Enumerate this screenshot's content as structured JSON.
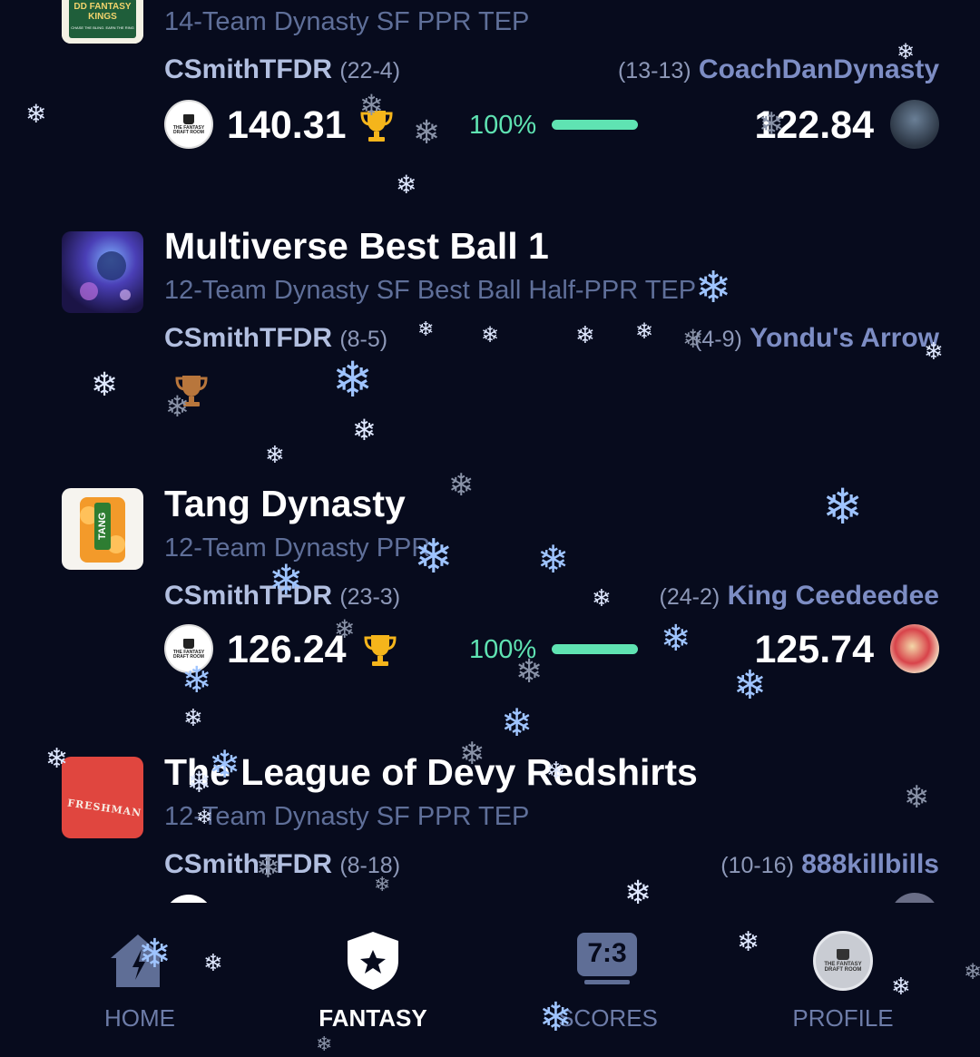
{
  "leagues": [
    {
      "name": "",
      "subtitle": "14-Team Dynasty SF PPR TEP",
      "thumb_text": "DD FANTASY KINGS",
      "thumb_tagline": "CHASE THE BLING. EARN THE RING",
      "my_team": "CSmithTFDR",
      "my_record": "(22-4)",
      "opponent": "CoachDanDynasty",
      "opponent_record": "(13-13)",
      "my_score": "140.31",
      "opponent_score": "122.84",
      "progress": "100%",
      "progress_value": 1.0
    },
    {
      "name": "Multiverse Best Ball 1",
      "subtitle": "12-Team Dynasty SF Best Ball Half-PPR TEP",
      "my_team": "CSmithTFDR",
      "my_record": "(8-5)",
      "opponent": "Yondu's Arrow",
      "opponent_record": "(4-9)"
    },
    {
      "name": "Tang Dynasty",
      "subtitle": "12-Team Dynasty PPR",
      "thumb_text": "TANG",
      "my_team": "CSmithTFDR",
      "my_record": "(23-3)",
      "opponent": "King Ceedeedee",
      "opponent_record": "(24-2)",
      "my_score": "126.24",
      "opponent_score": "125.74",
      "progress": "100%",
      "progress_value": 1.0
    },
    {
      "name": "The League of Devy Redshirts",
      "subtitle": "12-Team Dynasty SF PPR TEP",
      "thumb_text": "FRESHMAN",
      "my_team": "CSmithTFDR",
      "my_record": "(8-18)",
      "opponent": "888killbills",
      "opponent_record": "(10-16)"
    }
  ],
  "avatar_text": "THE FANTASY DRAFT ROOM",
  "nav": {
    "home": "HOME",
    "fantasy": "FANTASY",
    "scores": "SCORES",
    "scores_icon_text": "7:3",
    "profile": "PROFILE",
    "active": "fantasy"
  },
  "colors": {
    "background": "#070b1d",
    "accent_green": "#5fe3b2",
    "team_name": "#b2bfe0",
    "opponent_name": "#7d8dc4",
    "subtitle": "#5f6f99",
    "trophy_gold": "#f5b51b"
  },
  "icons": [
    "trophy-icon",
    "home-icon",
    "fantasy-shield-star-icon",
    "scoreboard-icon",
    "profile-avatar",
    "snowflake-icon"
  ]
}
